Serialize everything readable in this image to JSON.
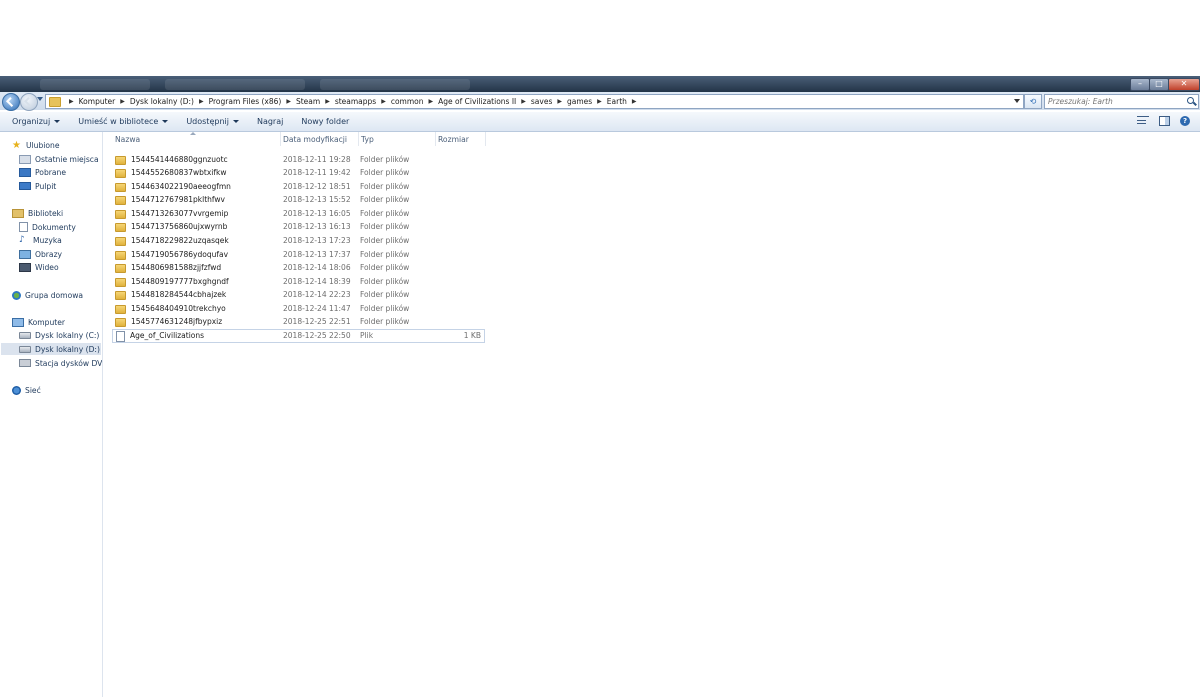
{
  "window": {
    "buttons": {
      "minimize": "–",
      "maximize": "□",
      "close": "✕"
    }
  },
  "address_bar": {
    "crumbs": [
      "Komputer",
      "Dysk lokalny (D:)",
      "Program Files (x86)",
      "Steam",
      "steamapps",
      "common",
      "Age of Civilizations II",
      "saves",
      "games",
      "Earth"
    ],
    "refresh_symbol": "⟲",
    "search_placeholder": "Przeszukaj: Earth"
  },
  "toolbar": {
    "organize": "Organizuj",
    "include_in_library": "Umieść w bibliotece",
    "share": "Udostępnij",
    "burn": "Nagraj",
    "new_folder": "Nowy folder",
    "help": "?"
  },
  "nav": {
    "favorites": "Ulubione",
    "recent": "Ostatnie miejsca",
    "downloads": "Pobrane",
    "desktop": "Pulpit",
    "libraries": "Biblioteki",
    "documents": "Dokumenty",
    "music": "Muzyka",
    "pictures": "Obrazy",
    "videos": "Wideo",
    "homegroup": "Grupa domowa",
    "computer": "Komputer",
    "drive_c": "Dysk lokalny (C:)",
    "drive_d": "Dysk lokalny (D:)",
    "dvd": "Stacja dysków DVD R",
    "network": "Sieć"
  },
  "columns": {
    "name": "Nazwa",
    "date": "Data modyfikacji",
    "type": "Typ",
    "size": "Rozmiar"
  },
  "files": [
    {
      "name": "1544541446880ggnzuotc",
      "date": "2018-12-11 19:28",
      "type": "Folder plików",
      "size": ""
    },
    {
      "name": "1544552680837wbtxifkw",
      "date": "2018-12-11 19:42",
      "type": "Folder plików",
      "size": ""
    },
    {
      "name": "1544634022190aeeogfmn",
      "date": "2018-12-12 18:51",
      "type": "Folder plików",
      "size": ""
    },
    {
      "name": "1544712767981pklthfwv",
      "date": "2018-12-13 15:52",
      "type": "Folder plików",
      "size": ""
    },
    {
      "name": "1544713263077vvrgemip",
      "date": "2018-12-13 16:05",
      "type": "Folder plików",
      "size": ""
    },
    {
      "name": "1544713756860ujxwyrnb",
      "date": "2018-12-13 16:13",
      "type": "Folder plików",
      "size": ""
    },
    {
      "name": "1544718229822uzqasqek",
      "date": "2018-12-13 17:23",
      "type": "Folder plików",
      "size": ""
    },
    {
      "name": "1544719056786ydoqufav",
      "date": "2018-12-13 17:37",
      "type": "Folder plików",
      "size": ""
    },
    {
      "name": "1544806981588zjjfzfwd",
      "date": "2018-12-14 18:06",
      "type": "Folder plików",
      "size": ""
    },
    {
      "name": "1544809197777bxghgndf",
      "date": "2018-12-14 18:39",
      "type": "Folder plików",
      "size": ""
    },
    {
      "name": "1544818284544cbhajzek",
      "date": "2018-12-14 22:23",
      "type": "Folder plików",
      "size": ""
    },
    {
      "name": "1545648404910trekchyo",
      "date": "2018-12-24 11:47",
      "type": "Folder plików",
      "size": ""
    },
    {
      "name": "1545774631248jfbypxiz",
      "date": "2018-12-25 22:51",
      "type": "Folder plików",
      "size": ""
    },
    {
      "name": "Age_of_Civilizations",
      "date": "2018-12-25 22:50",
      "type": "Plik",
      "size": "1 KB"
    }
  ]
}
